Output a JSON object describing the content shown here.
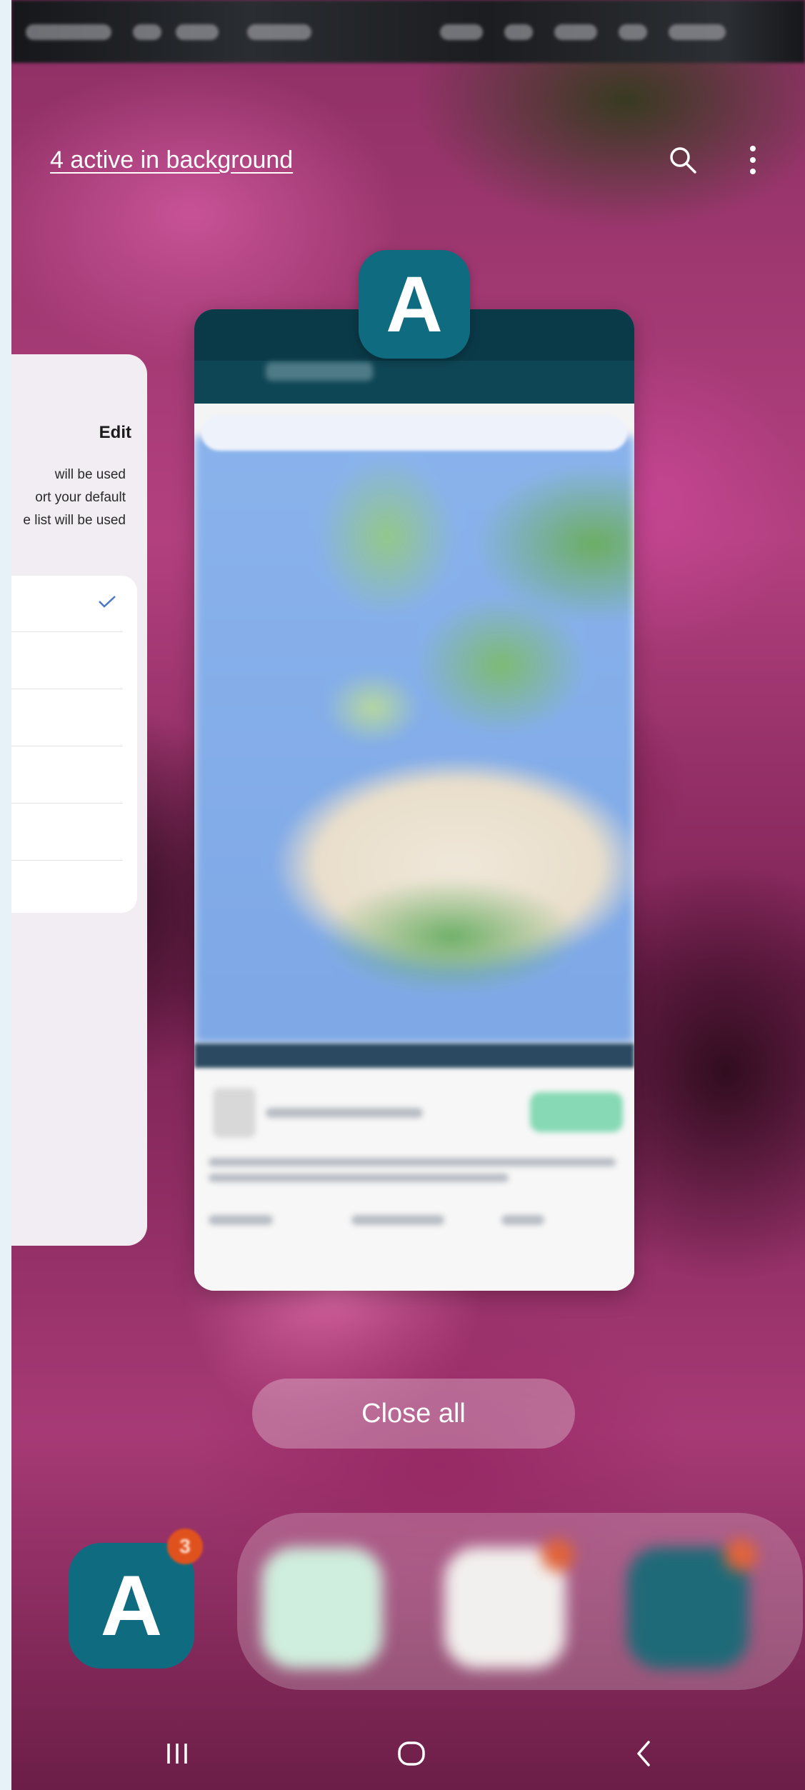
{
  "header": {
    "active_link": "4 active in background",
    "icons": {
      "search": "search-icon",
      "more": "more-vertical-icon"
    }
  },
  "left_card": {
    "edit_label": "Edit",
    "lines": [
      "will be used",
      "ort your default",
      "e list will be used"
    ],
    "first_item": ")",
    "check_icon": "check-icon"
  },
  "app_card": {
    "icon_letter": "A"
  },
  "close_all_label": "Close all",
  "dock": {
    "app_letter": "A",
    "badge_count": "3"
  },
  "nav": {
    "recent": "recent-apps-icon",
    "home": "home-icon",
    "back": "back-icon"
  },
  "colors": {
    "brand": "#0f6c80",
    "badge": "#e0521d",
    "check": "#4a78c8"
  }
}
